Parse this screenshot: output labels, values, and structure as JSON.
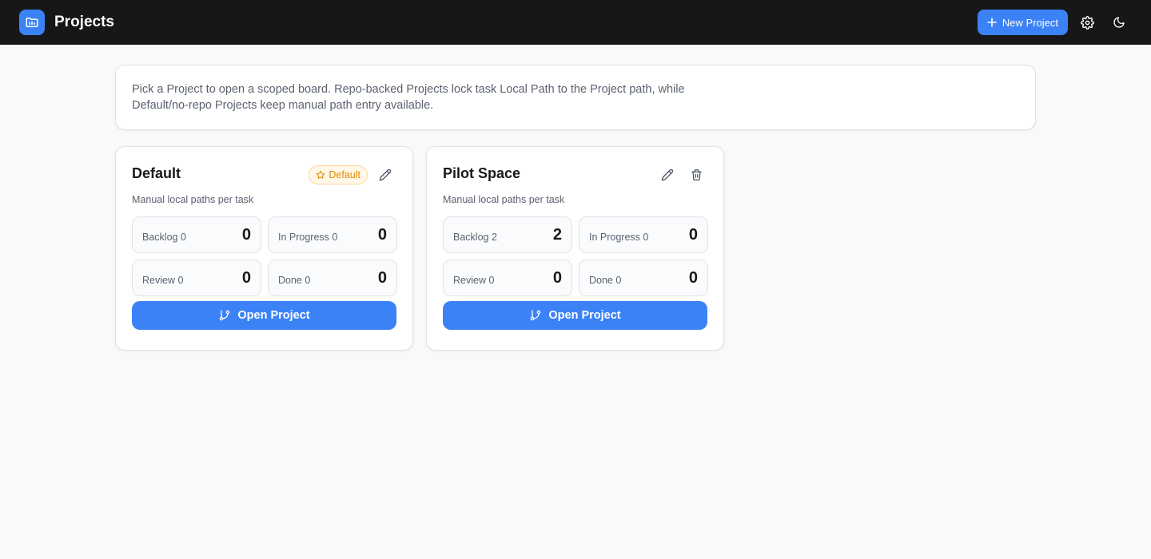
{
  "header": {
    "title": "Projects",
    "logo_icon": "folder-icon",
    "new_project_label": "New Project",
    "settings_icon": "gear-icon",
    "theme_icon": "moon-icon"
  },
  "info": {
    "text": "Pick a Project to open a scoped board. Repo-backed Projects lock task Local Path to the Project path, while Default/no-repo Projects keep manual path entry available."
  },
  "projects": [
    {
      "name": "Default",
      "badge": "Default",
      "subtitle": "Manual local paths per task",
      "stats": [
        {
          "label": "Backlog 0",
          "value": "0"
        },
        {
          "label": "In Progress 0",
          "value": "0"
        },
        {
          "label": "Review 0",
          "value": "0"
        },
        {
          "label": "Done 0",
          "value": "0"
        }
      ],
      "open_label": "Open Project"
    },
    {
      "name": "Pilot Space",
      "subtitle": "Manual local paths per task",
      "stats": [
        {
          "label": "Backlog 2",
          "value": "2"
        },
        {
          "label": "In Progress 0",
          "value": "0"
        },
        {
          "label": "Review 0",
          "value": "0"
        },
        {
          "label": "Done 0",
          "value": "0"
        }
      ],
      "open_label": "Open Project"
    }
  ],
  "colors": {
    "accent": "#3b82f6",
    "header_bg": "#17171a",
    "badge_text": "#e08a00"
  }
}
